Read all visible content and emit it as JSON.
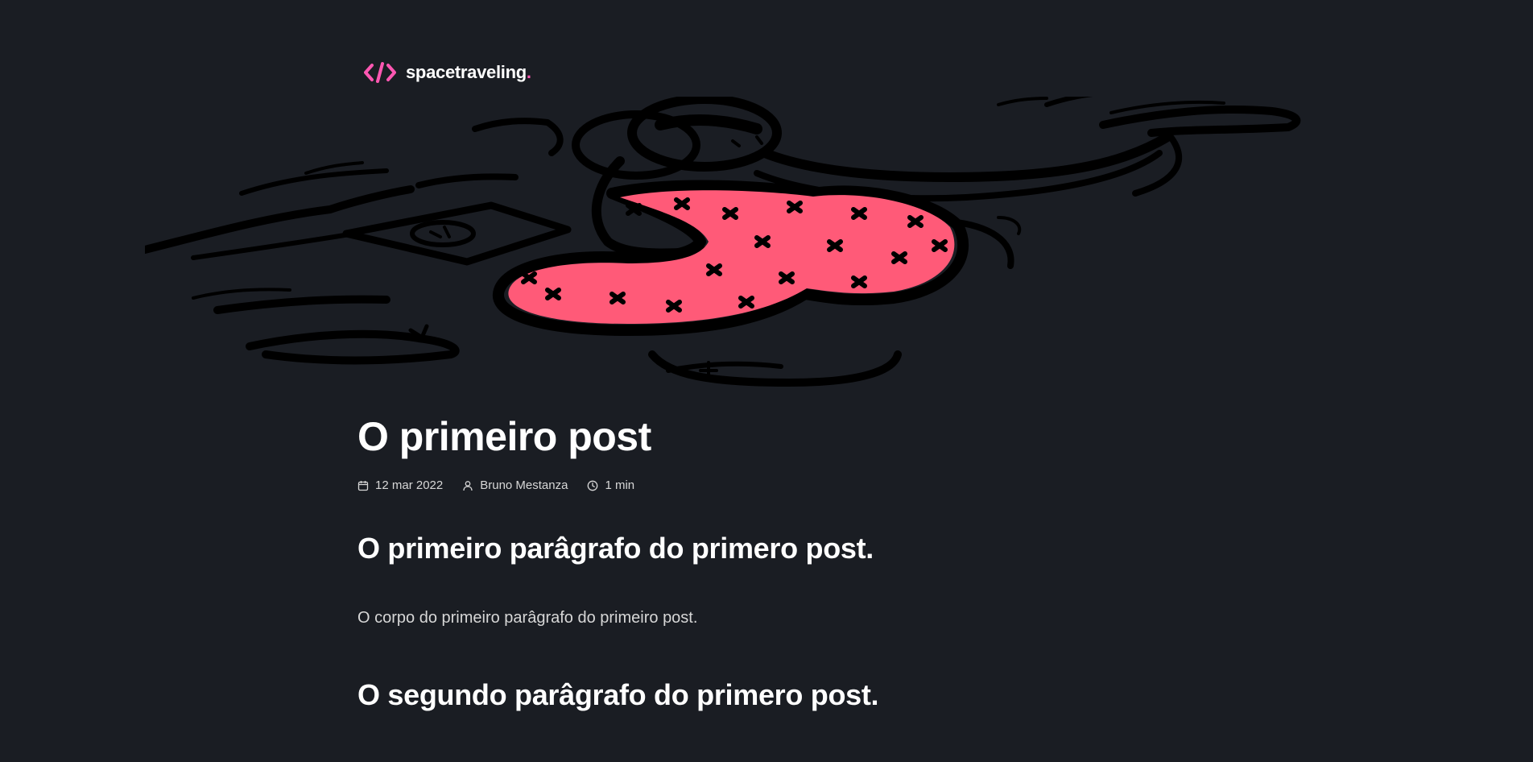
{
  "header": {
    "logo_icon": "code-brackets-icon",
    "brand_name": "spacetraveling",
    "brand_dot": ".",
    "accent_color": "#ff57b2"
  },
  "banner": {
    "illustration": "floating-person-illustration",
    "highlight_color": "#ff5a78"
  },
  "post": {
    "title": "O primeiro post",
    "meta": {
      "date_icon": "calendar-icon",
      "date": "12 mar 2022",
      "author_icon": "user-icon",
      "author": "Bruno Mestanza",
      "reading_time_icon": "clock-icon",
      "reading_time": "1 min"
    },
    "sections": [
      {
        "heading": "O primeiro parâgrafo do primero post.",
        "body": "O corpo do primeiro parâgrafo do primeiro post."
      },
      {
        "heading": "O segundo parâgrafo do primero post."
      }
    ]
  },
  "colors": {
    "background": "#1a1d23",
    "text": "#ffffff",
    "muted_text": "#d7d7d7"
  }
}
